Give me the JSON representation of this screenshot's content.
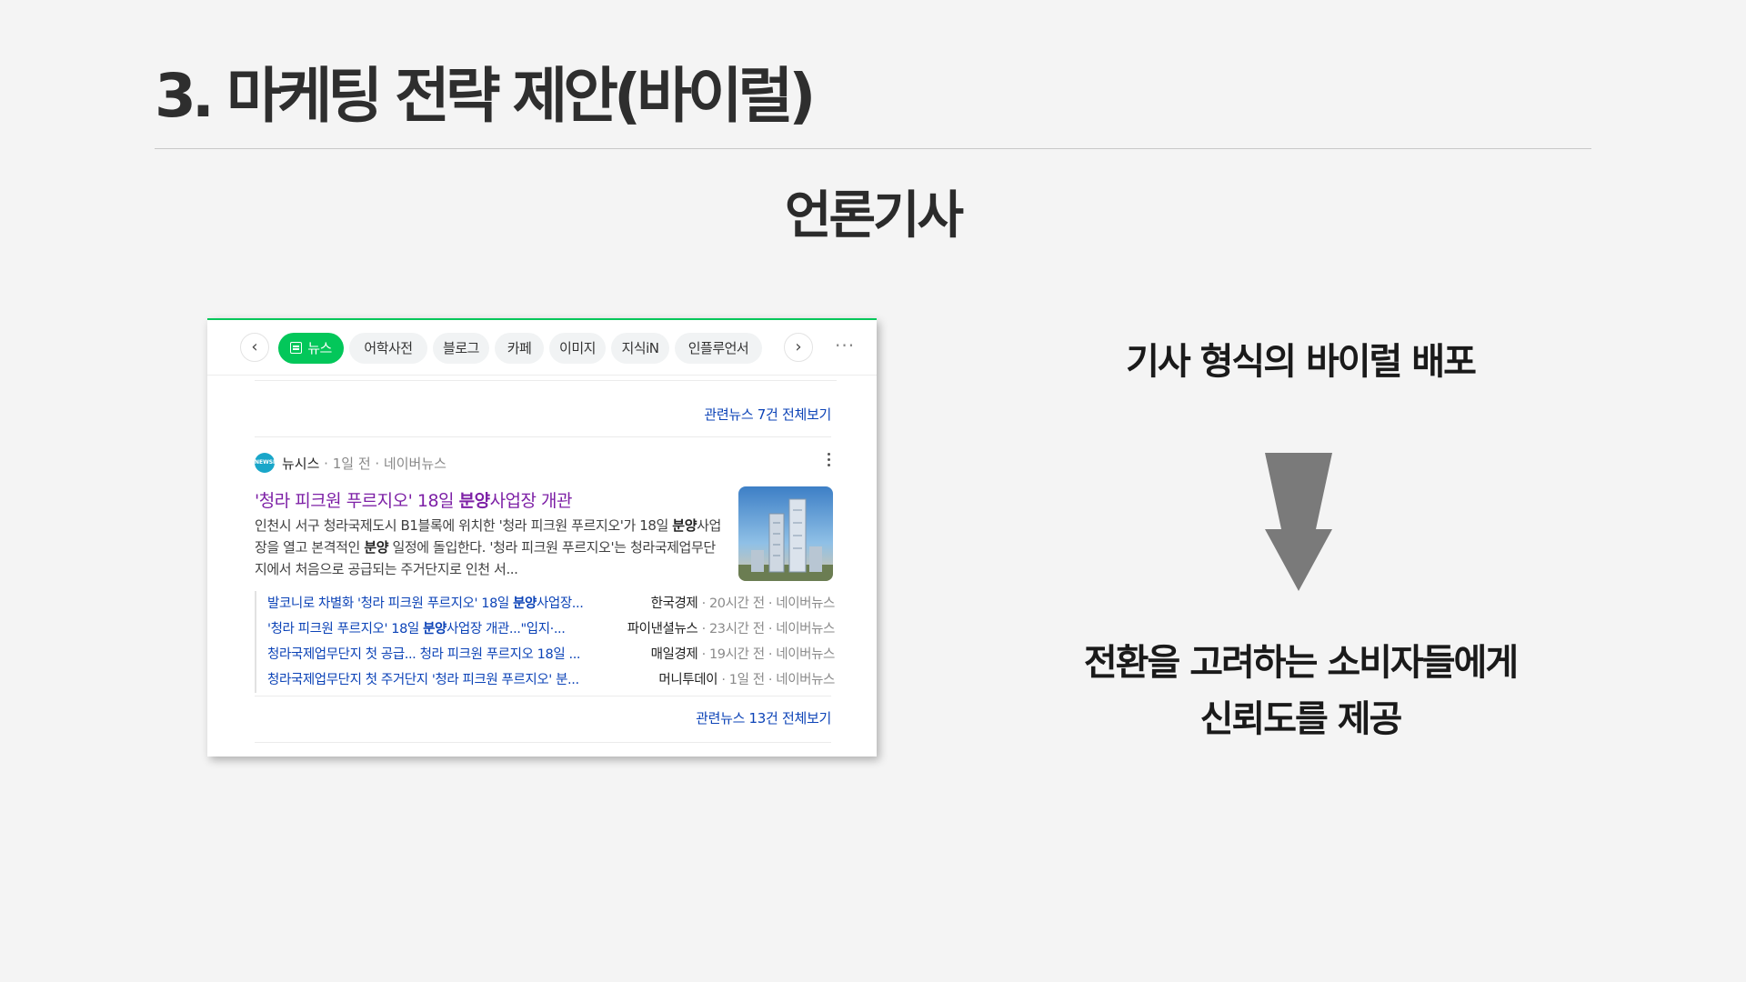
{
  "slide": {
    "title": "3. 마케팅 전략 제안(바이럴)",
    "subtitle": "언론기사"
  },
  "search_ui": {
    "tabs": [
      "뉴스",
      "어학사전",
      "블로그",
      "카페",
      "이미지",
      "지식iN",
      "인플루언서"
    ],
    "active_tab": "뉴스",
    "accent_color": "#03c75a",
    "prev_icon": "‹",
    "next_icon": "›",
    "more_icon": "···",
    "related_more_1": "관련뉴스 7건 전체보기",
    "article": {
      "press": "뉴시스",
      "press_logo_text": "NEWSIS",
      "meta": " · 1일 전 · 네이버뉴스",
      "headline_pre": "'청라 피크원 푸르지오' 18일 ",
      "headline_bold": "분양",
      "headline_post": "사업장 개관",
      "summary_1": "인천시 서구 청라국제도시 B1블록에 위치한 '청라 피크원 푸르지오'가 18일 ",
      "summary_bold_1": "분양",
      "summary_2": "사업장을 열고 본격적인 ",
      "summary_bold_2": "분양",
      "summary_3": " 일정에 돌입한다. '청라 피크원 푸르지오'는 청라국제업무단지에서 처음으로 공급되는 주거단지로 인천 서..."
    },
    "related_news": [
      {
        "pre": "발코니로 차별화 '청라 피크원 푸르지오' 18일 ",
        "bold": "분양",
        "post": "사업장...",
        "press": "한국경제",
        "meta": " · 20시간 전 · 네이버뉴스"
      },
      {
        "pre": "'청라 피크원 푸르지오' 18일 ",
        "bold": "분양",
        "post": "사업장 개관...\"입지·...",
        "press": "파이낸셜뉴스",
        "meta": " · 23시간 전 · 네이버뉴스"
      },
      {
        "pre": "청라국제업무단지 첫 공급... 청라 피크원 푸르지오 18일 ...",
        "bold": "",
        "post": "",
        "press": "매일경제",
        "meta": " · 19시간 전 · 네이버뉴스"
      },
      {
        "pre": "청라국제업무단지 첫 주거단지 '청라 피크원 푸르지오' 분...",
        "bold": "",
        "post": "",
        "press": "머니투데이",
        "meta": " · 1일 전 · 네이버뉴스"
      }
    ],
    "related_more_2": "관련뉴스 13건 전체보기"
  },
  "right_panel": {
    "point_1": "기사 형식의 바이럴 배포",
    "arrow_icon": "down-arrow-icon",
    "point_2_line_1": "전환을 고려하는 소비자들에게",
    "point_2_line_2": "신뢰도를 제공"
  }
}
